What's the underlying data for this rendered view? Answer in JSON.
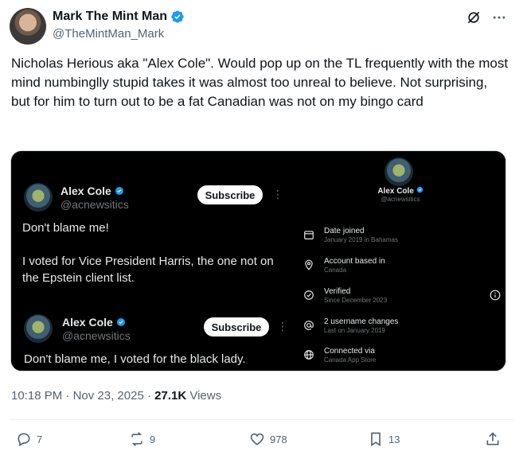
{
  "author": {
    "display_name": "Mark The Mint Man",
    "handle": "@TheMintMan_Mark"
  },
  "tweet": {
    "text": "Nicholas Herious aka \"Alex Cole\". Would pop up on the TL frequently with the most mind numbinglly stupid takes it was almost too unreal to believe. Not surprising, but for him to turn out to be a fat Canadian was not on my bingo card"
  },
  "media": {
    "card1": {
      "name": "Alex Cole",
      "handle": "@acnewsitics",
      "subscribe": "Subscribe",
      "line1": "Don't blame me!",
      "line2": "I voted for Vice President Harris, the one not on the Epstein client list."
    },
    "card2": {
      "name": "Alex Cole",
      "handle": "@acnewsitics",
      "subscribe": "Subscribe",
      "line1": "Don't blame me, I voted for the black lady."
    },
    "profile": {
      "name": "Alex Cole",
      "handle": "@acnewsitics",
      "rows": [
        {
          "icon": "calendar-icon",
          "title": "Date joined",
          "sub": "January 2019 in Bahamas"
        },
        {
          "icon": "location-icon",
          "title": "Account based in",
          "sub": "Canada"
        },
        {
          "icon": "verified-check-icon",
          "title": "Verified",
          "sub": "Since December 2023"
        },
        {
          "icon": "at-icon",
          "title": "2 username changes",
          "sub": "Last on January 2019"
        },
        {
          "icon": "globe-icon",
          "title": "Connected via",
          "sub": "Canada App Store"
        }
      ]
    }
  },
  "meta": {
    "time": "10:18 PM",
    "date": "Nov 23, 2025",
    "views_count": "27.1K",
    "views_label": "Views"
  },
  "actions": {
    "replies": "7",
    "reposts": "9",
    "likes": "978",
    "bookmarks": "13"
  },
  "colors": {
    "verified_blue": "#1d9bf0",
    "text_primary": "#0f1419",
    "text_secondary": "#536471"
  }
}
